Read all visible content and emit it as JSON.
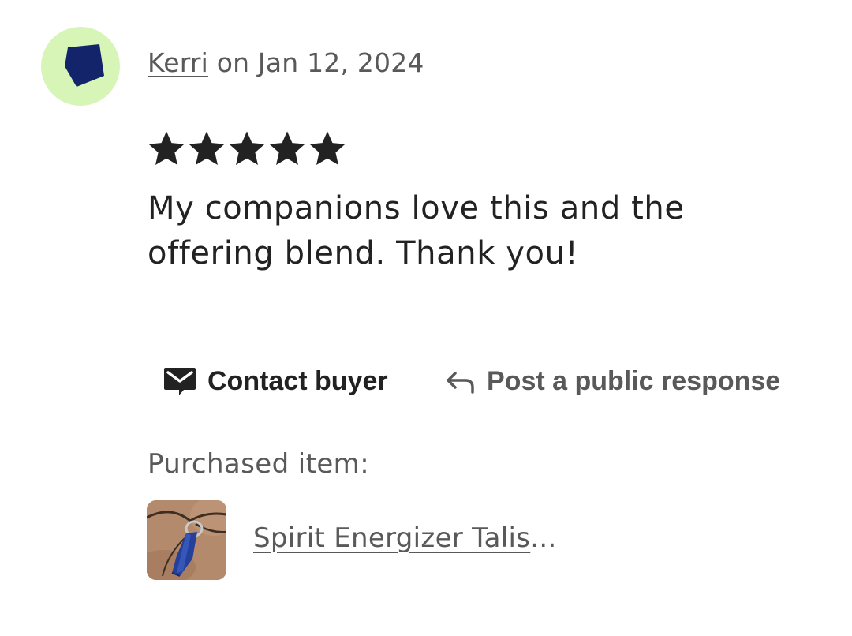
{
  "review": {
    "avatar_color": "#d8f5b8",
    "avatar_shape_color": "#14246b",
    "reviewer_name": "Kerri",
    "date_text": " on Jan 12, 2024",
    "rating": 5,
    "rating_max": 5,
    "star_icon": "star-icon",
    "text": "My companions love this and the offering blend. Thank you!"
  },
  "actions": {
    "contact_buyer": {
      "label": "Contact buyer",
      "icon": "mail-icon"
    },
    "public_response": {
      "label": "Post a public response",
      "icon": "reply-arrow-icon"
    }
  },
  "purchase": {
    "label": "Purchased item:",
    "item_name": "Spirit Energizer Talis",
    "ellipsis": "...",
    "thumbnail": "lapis-pendant-photo"
  },
  "colors": {
    "text_primary": "#222222",
    "text_secondary": "#595959",
    "background": "#ffffff"
  }
}
